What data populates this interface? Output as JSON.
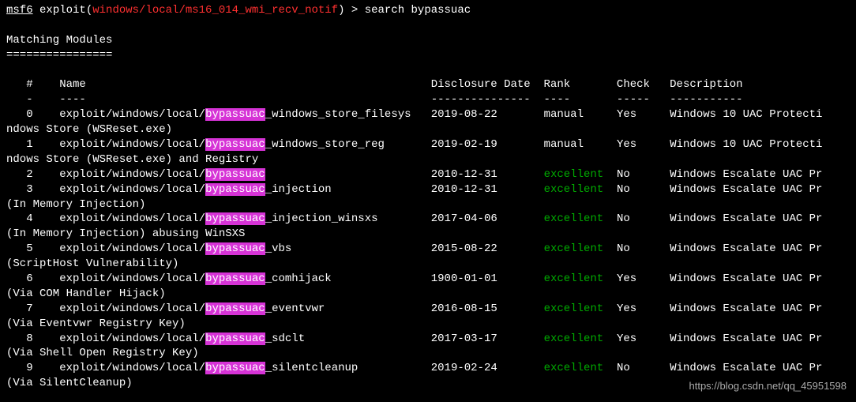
{
  "prompt": {
    "prefix": "msf6",
    "module_open": " exploit(",
    "module": "windows/local/ms16_014_wmi_recv_notif",
    "module_close": ") > ",
    "command": "search bypassuac"
  },
  "heading": "Matching Modules",
  "heading_underline": "================",
  "columns": {
    "idx": "#",
    "name": "Name",
    "date": "Disclosure Date",
    "rank": "Rank",
    "check": "Check",
    "desc": "Description"
  },
  "underline": {
    "idx": "-",
    "name": "----",
    "date": "---------------",
    "rank": "----",
    "check": "-----",
    "desc": "-----------"
  },
  "path_prefix": "exploit/windows/local/",
  "highlight": "bypassuac",
  "rows": [
    {
      "idx": "0",
      "suffix": "_windows_store_filesys",
      "date": "2019-08-22",
      "rank": "manual",
      "rank_color": "white",
      "check": "Yes",
      "desc": "Windows 10 UAC Protecti",
      "wrap": "ndows Store (WSReset.exe)"
    },
    {
      "idx": "1",
      "suffix": "_windows_store_reg",
      "date": "2019-02-19",
      "rank": "manual",
      "rank_color": "white",
      "check": "Yes",
      "desc": "Windows 10 UAC Protecti",
      "wrap": "ndows Store (WSReset.exe) and Registry"
    },
    {
      "idx": "2",
      "suffix": "",
      "date": "2010-12-31",
      "rank": "excellent",
      "rank_color": "green",
      "check": "No",
      "desc": "Windows Escalate UAC Pr",
      "wrap": ""
    },
    {
      "idx": "3",
      "suffix": "_injection",
      "date": "2010-12-31",
      "rank": "excellent",
      "rank_color": "green",
      "check": "No",
      "desc": "Windows Escalate UAC Pr",
      "wrap": "(In Memory Injection)"
    },
    {
      "idx": "4",
      "suffix": "_injection_winsxs",
      "date": "2017-04-06",
      "rank": "excellent",
      "rank_color": "green",
      "check": "No",
      "desc": "Windows Escalate UAC Pr",
      "wrap": "(In Memory Injection) abusing WinSXS"
    },
    {
      "idx": "5",
      "suffix": "_vbs",
      "date": "2015-08-22",
      "rank": "excellent",
      "rank_color": "green",
      "check": "No",
      "desc": "Windows Escalate UAC Pr",
      "wrap": "(ScriptHost Vulnerability)"
    },
    {
      "idx": "6",
      "suffix": "_comhijack",
      "date": "1900-01-01",
      "rank": "excellent",
      "rank_color": "green",
      "check": "Yes",
      "desc": "Windows Escalate UAC Pr",
      "wrap": "(Via COM Handler Hijack)"
    },
    {
      "idx": "7",
      "suffix": "_eventvwr",
      "date": "2016-08-15",
      "rank": "excellent",
      "rank_color": "green",
      "check": "Yes",
      "desc": "Windows Escalate UAC Pr",
      "wrap": "(Via Eventvwr Registry Key)"
    },
    {
      "idx": "8",
      "suffix": "_sdclt",
      "date": "2017-03-17",
      "rank": "excellent",
      "rank_color": "green",
      "check": "Yes",
      "desc": "Windows Escalate UAC Pr",
      "wrap": "(Via Shell Open Registry Key)"
    },
    {
      "idx": "9",
      "suffix": "_silentcleanup",
      "date": "2019-02-24",
      "rank": "excellent",
      "rank_color": "green",
      "check": "No",
      "desc": "Windows Escalate UAC Pr",
      "wrap": "(Via SilentCleanup)"
    }
  ],
  "watermark": "https://blog.csdn.net/qq_45951598"
}
